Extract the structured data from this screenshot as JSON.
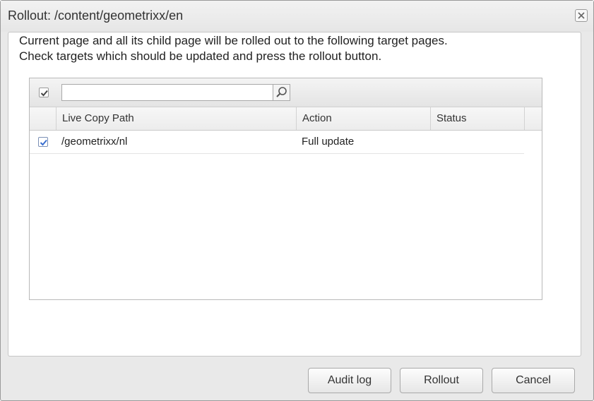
{
  "dialog": {
    "title": "Rollout: /content/geometrixx/en",
    "description_line1": "Current page and all its child page will be rolled out to the following target pages.",
    "description_line2": "Check targets which should be updated and press the rollout button."
  },
  "grid": {
    "select_all_checked": true,
    "search": {
      "value": "",
      "placeholder": ""
    },
    "columns": [
      "Live Copy Path",
      "Action",
      "Status"
    ],
    "rows": [
      {
        "checked": true,
        "path": "/geometrixx/nl",
        "action": "Full update",
        "status": ""
      }
    ]
  },
  "buttons": {
    "audit_log": "Audit log",
    "rollout": "Rollout",
    "cancel": "Cancel"
  },
  "icons": {
    "close": "close-icon",
    "search": "search-icon",
    "check": "checkmark-icon"
  },
  "colors": {
    "checkbox_blue": "#3a6fd0",
    "checkbox_gray": "#444444"
  }
}
